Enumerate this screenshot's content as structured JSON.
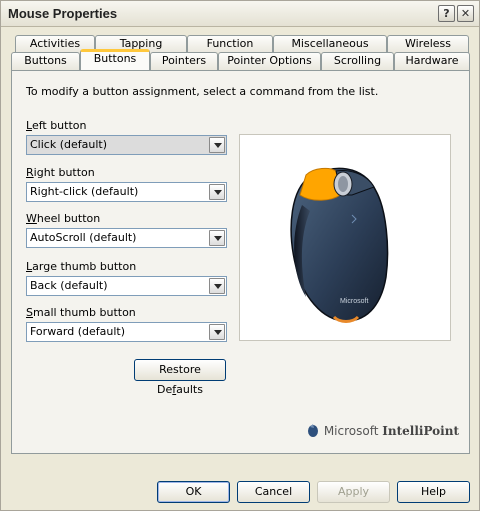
{
  "window": {
    "title": "Mouse Properties",
    "help_glyph": "?",
    "close_glyph": "✕"
  },
  "tabs_back": [
    "Activities",
    "Tapping",
    "Function",
    "Miscellaneous",
    "Wireless"
  ],
  "tabs_front": [
    "Buttons",
    "Buttons",
    "Pointers",
    "Pointer Options",
    "Scrolling",
    "Hardware"
  ],
  "panel": {
    "instruction": "To modify a button assignment, select a command from the list.",
    "fields": [
      {
        "label_hot": "L",
        "label_rest": "eft button",
        "value": "Click (default)"
      },
      {
        "label_hot": "R",
        "label_rest": "ight button",
        "value": "Right-click (default)"
      },
      {
        "label_hot": "W",
        "label_rest": "heel button",
        "value": "AutoScroll (default)"
      },
      {
        "label_hot": "L",
        "label_rest": "arge thumb button",
        "value": "Back (default)"
      },
      {
        "label_hot": "S",
        "label_rest": "mall thumb button",
        "value": "Forward (default)"
      }
    ],
    "restore_label_pre": "Restore De",
    "restore_label_hot": "f",
    "restore_label_post": "aults",
    "brand_ms": "Microsoft",
    "brand_product": "IntelliPoint",
    "device_label": "Microsoft"
  },
  "footer": {
    "ok": "OK",
    "cancel": "Cancel",
    "apply": "Apply",
    "help": "Help"
  },
  "colors": {
    "highlight": "#ffa500",
    "tab_accent": "#ffc83c"
  }
}
